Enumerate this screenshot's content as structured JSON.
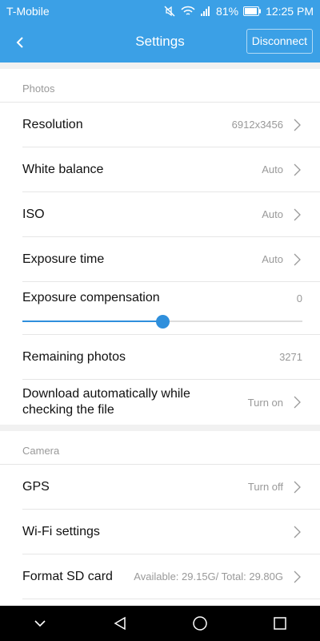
{
  "status_bar": {
    "carrier": "T-Mobile",
    "battery": "81%",
    "time": "12:25 PM",
    "icons": [
      "mute-icon",
      "wifi-icon",
      "signal-icon",
      "battery-icon"
    ]
  },
  "header": {
    "title": "Settings",
    "back_icon": "back-arrow-icon",
    "disconnect_label": "Disconnect"
  },
  "photos": {
    "section_title": "Photos",
    "resolution": {
      "label": "Resolution",
      "value": "6912x3456"
    },
    "white_balance": {
      "label": "White balance",
      "value": "Auto"
    },
    "iso": {
      "label": "ISO",
      "value": "Auto"
    },
    "exposure_time": {
      "label": "Exposure time",
      "value": "Auto"
    },
    "exposure_compensation": {
      "label": "Exposure compensation",
      "value": "0",
      "slider_fraction": 0.5
    },
    "remaining": {
      "label": "Remaining photos",
      "value": "3271"
    },
    "download": {
      "label_line1": "Download automatically while",
      "label_line2": "checking the file",
      "value": "Turn on"
    }
  },
  "camera": {
    "section_title": "Camera",
    "gps": {
      "label": "GPS",
      "value": "Turn off"
    },
    "wifi": {
      "label": "Wi-Fi settings"
    },
    "format": {
      "label": "Format SD card",
      "value": "Available: 29.15G/ Total: 29.80G"
    }
  },
  "nav_bar": {
    "icons": [
      "hide-keyboard-icon",
      "back-icon",
      "home-icon",
      "recents-icon"
    ]
  },
  "colors": {
    "accent": "#3ba0e6",
    "slider": "#2f8fdc",
    "secondary_text": "#999999",
    "background": "#f1f1f1"
  }
}
